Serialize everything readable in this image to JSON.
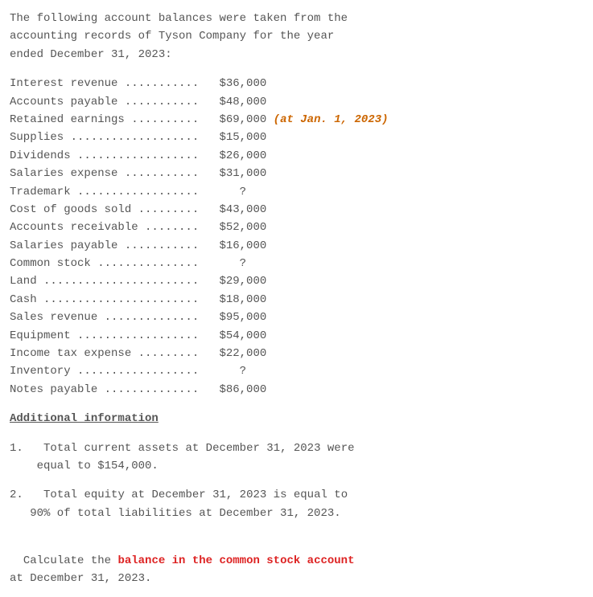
{
  "intro": "The following account balances were taken from the\naccounting records of Tyson Company for the year\nended December 31, 2023:",
  "accounts": [
    {
      "label": "Interest revenue ...........",
      "value": "$36,000",
      "note": ""
    },
    {
      "label": "Accounts payable ...........",
      "value": "$48,000",
      "note": ""
    },
    {
      "label": "Retained earnings ..........",
      "value": "$69,000",
      "note": "(at Jan. 1, 2023)"
    },
    {
      "label": "Supplies ...................",
      "value": "$15,000",
      "note": ""
    },
    {
      "label": "Dividends ..................",
      "value": "$26,000",
      "note": ""
    },
    {
      "label": "Salaries expense ...........",
      "value": "$31,000",
      "note": ""
    },
    {
      "label": "Trademark ..................",
      "value": "   ?",
      "note": ""
    },
    {
      "label": "Cost of goods sold .........",
      "value": "$43,000",
      "note": ""
    },
    {
      "label": "Accounts receivable ........",
      "value": "$52,000",
      "note": ""
    },
    {
      "label": "Salaries payable ...........",
      "value": "$16,000",
      "note": ""
    },
    {
      "label": "Common stock ...............",
      "value": "   ?",
      "note": ""
    },
    {
      "label": "Land .......................",
      "value": "$29,000",
      "note": ""
    },
    {
      "label": "Cash .......................",
      "value": "$18,000",
      "note": ""
    },
    {
      "label": "Sales revenue ..............",
      "value": "$95,000",
      "note": ""
    },
    {
      "label": "Equipment ..................",
      "value": "$54,000",
      "note": ""
    },
    {
      "label": "Income tax expense .........",
      "value": "$22,000",
      "note": ""
    },
    {
      "label": "Inventory ..................",
      "value": "   ?",
      "note": ""
    },
    {
      "label": "Notes payable ..............",
      "value": "$86,000",
      "note": ""
    }
  ],
  "additional_heading": "Additional information",
  "info1_num": "1.",
  "info1_text": "Total current assets at December 31, 2023 were\n    equal to $154,000.",
  "info2_num": "2.",
  "info2_text": "Total equity at December 31, 2023 is equal to\n   90% of total liabilities at December 31, 2023.",
  "calc_prefix": "Calculate the ",
  "calc_highlight": "balance in the common stock account",
  "calc_suffix": "\nat December 31, 2023."
}
